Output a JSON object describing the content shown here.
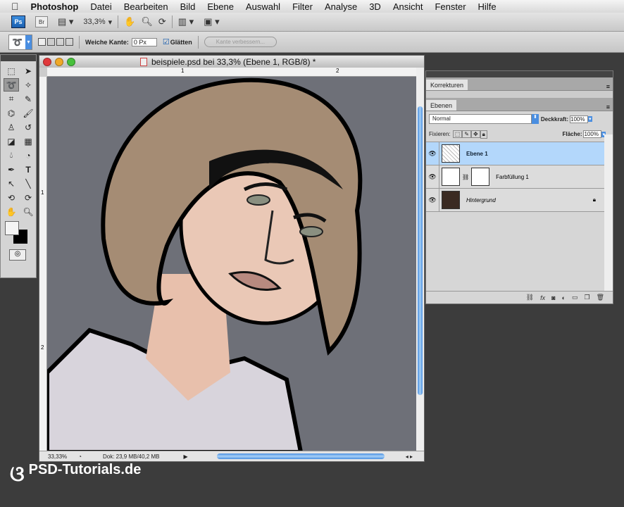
{
  "menubar": {
    "app": "Photoshop",
    "items": [
      "Datei",
      "Bearbeiten",
      "Bild",
      "Ebene",
      "Auswahl",
      "Filter",
      "Analyse",
      "3D",
      "Ansicht",
      "Fenster",
      "Hilfe"
    ]
  },
  "appbar": {
    "ps": "Ps",
    "br": "Br",
    "zoom": "33,3%"
  },
  "options": {
    "feather_label": "Weiche Kante:",
    "feather_value": "0 Px",
    "antialias_label": "Glätten",
    "refine_label": "Kante verbessern..."
  },
  "document": {
    "title": "beispiele.psd bei 33,3% (Ebene 1, RGB/8) *",
    "ruler_top": [
      "1",
      "2"
    ],
    "ruler_left": [
      "1",
      "2"
    ],
    "zoom": "33,33%",
    "doc_info": "Dok: 23,9 MB/40,2 MB"
  },
  "panels": {
    "adjust_tab": "Korrekturen",
    "layers_tab": "Ebenen",
    "blend_mode": "Normal",
    "opacity_label": "Deckkraft:",
    "opacity": "100%",
    "lock_label": "Fixieren:",
    "fill_label": "Fläche:",
    "fill": "100%",
    "layers": [
      {
        "name": "Ebene 1",
        "selected": true
      },
      {
        "name": "Farbfüllung 1",
        "selected": false
      },
      {
        "name": "Hintergrund",
        "selected": false,
        "locked": true
      }
    ]
  },
  "watermark": "PSD-Tutorials.de"
}
